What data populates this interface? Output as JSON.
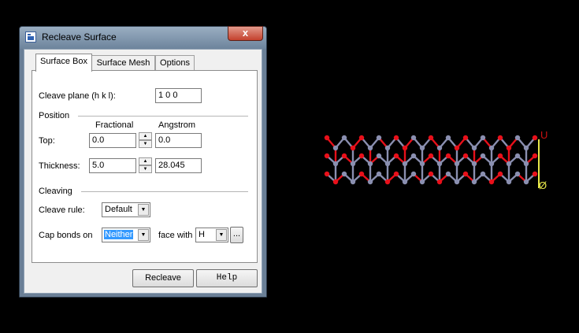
{
  "window": {
    "title": "Recleave Surface",
    "close_label": "x"
  },
  "tabs": [
    {
      "label": "Surface Box",
      "active": true
    },
    {
      "label": "Surface Mesh",
      "active": false
    },
    {
      "label": "Options",
      "active": false
    }
  ],
  "form": {
    "cleave_plane_label": "Cleave plane (h k l):",
    "cleave_plane_value": "1  0  0",
    "position_header": "Position",
    "col_fractional": "Fractional",
    "col_angstrom": "Angstrom",
    "top_label": "Top:",
    "top_fractional": "0.0",
    "top_angstrom": "0.0",
    "thickness_label": "Thickness:",
    "thickness_fractional": "5.0",
    "thickness_angstrom": "28.045",
    "cleaving_header": "Cleaving",
    "cleave_rule_label": "Cleave rule:",
    "cleave_rule_value": "Default",
    "cap_bonds_label": "Cap bonds on",
    "cap_bonds_value": "Neither",
    "face_with_label": "face with",
    "face_with_value": "H",
    "browse_label": "..."
  },
  "buttons": {
    "recleave": "Recleave",
    "help": "Help"
  },
  "viewer": {
    "axis_u_label": "U",
    "axis_origin_label": "Ø",
    "colors": {
      "oxygen": "#e8101a",
      "other_atom": "#8a8fb0",
      "bond_grey": "#8a8fb0",
      "axis_u": "#cc1010",
      "axis_origin": "#e8e84a"
    }
  }
}
